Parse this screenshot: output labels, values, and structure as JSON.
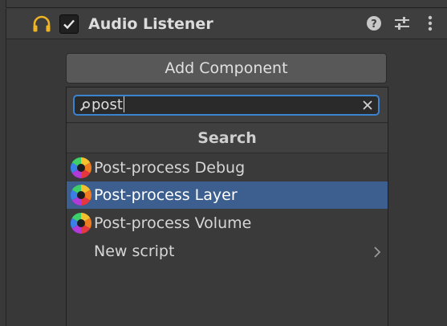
{
  "component": {
    "title": "Audio Listener",
    "enabled": true,
    "icon": "headphones-icon",
    "header_icons": [
      "help-icon",
      "presets-icon",
      "menu-icon"
    ]
  },
  "add_component": {
    "label": "Add Component"
  },
  "search": {
    "value": "post",
    "section_title": "Search"
  },
  "results": [
    {
      "label": "Post-process Debug",
      "icon": "post-process-icon",
      "selected": false
    },
    {
      "label": "Post-process Layer",
      "icon": "post-process-icon",
      "selected": true
    },
    {
      "label": "Post-process Volume",
      "icon": "post-process-icon",
      "selected": false
    },
    {
      "label": "New script",
      "icon": "",
      "selected": false,
      "has_submenu": true
    }
  ],
  "colors": {
    "accent": "#3b82cf",
    "selection": "#3d5f8f",
    "headphones": "#f0b323"
  }
}
